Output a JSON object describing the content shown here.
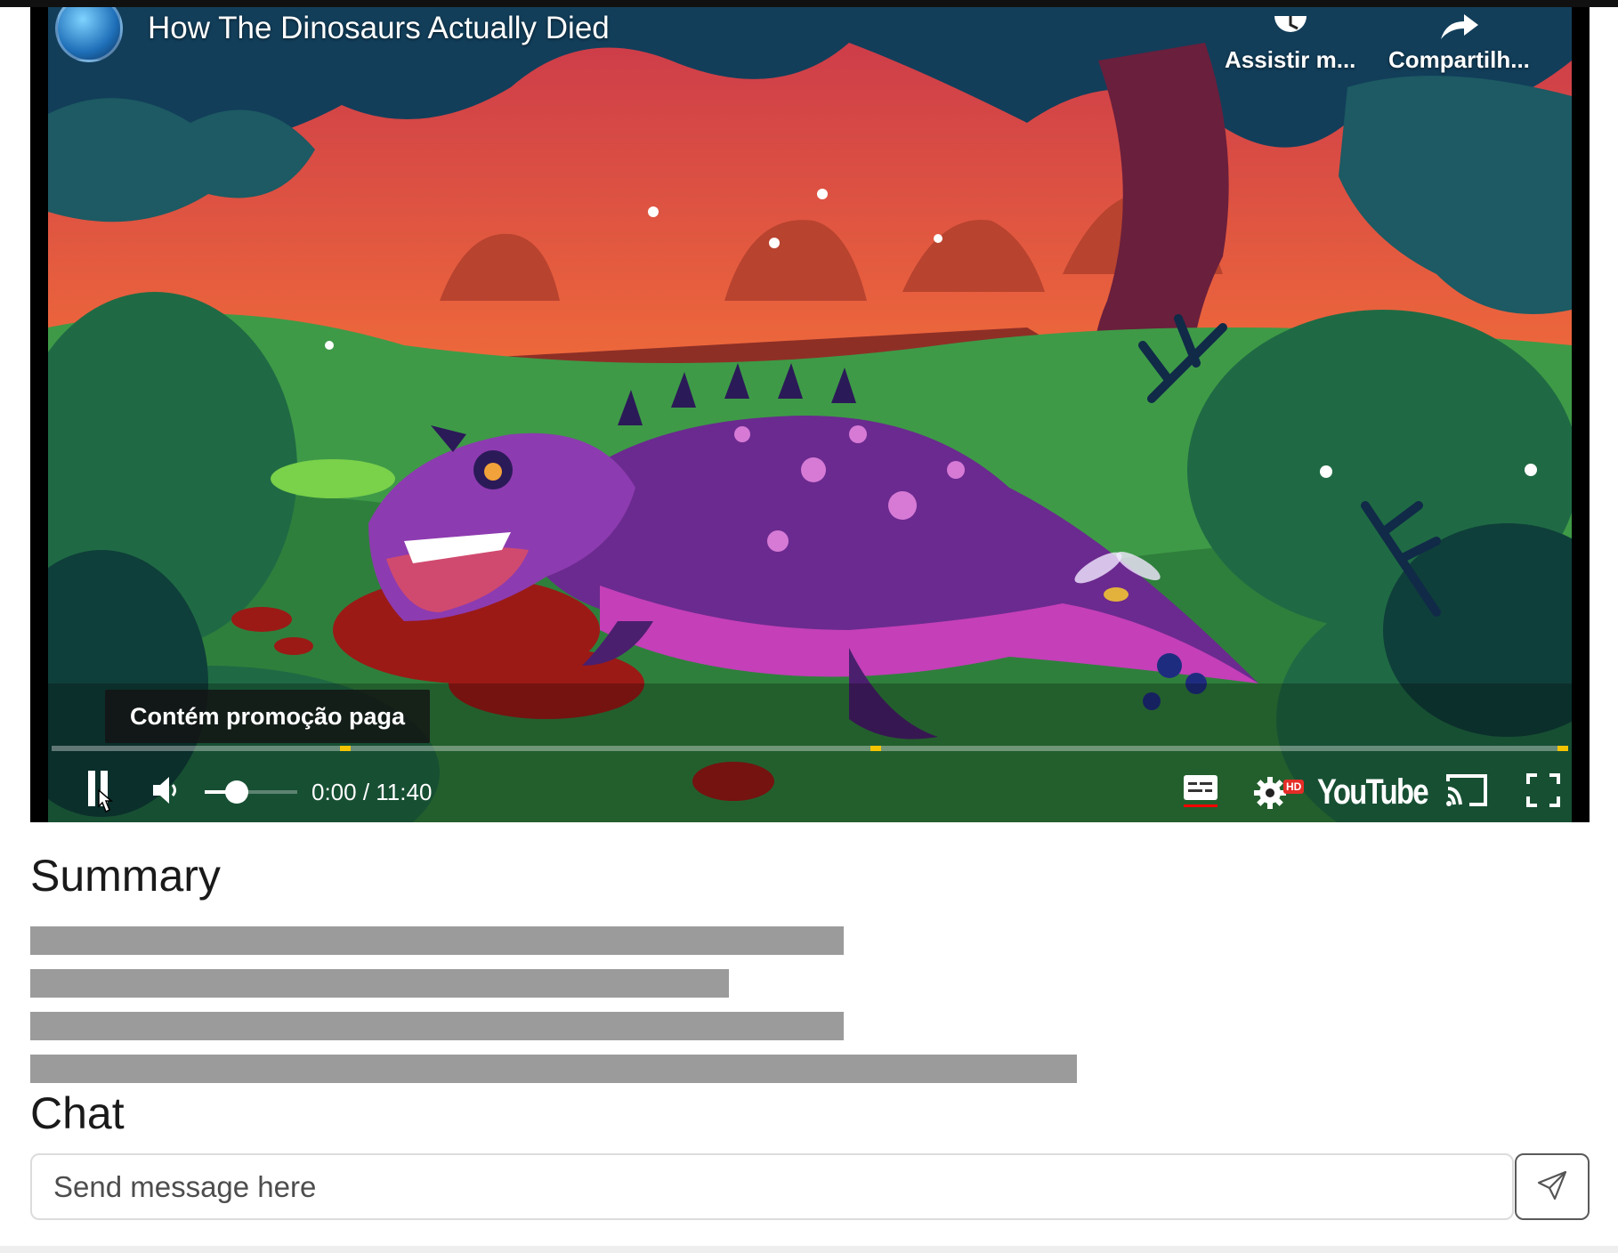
{
  "video": {
    "title": "How The Dinosaurs Actually Died",
    "channel_avatar_icon": "earth-avatar-icon",
    "actions": {
      "watch_later": {
        "label": "Assistir m...",
        "icon": "clock-icon"
      },
      "share": {
        "label": "Compartilh...",
        "icon": "share-arrow-icon"
      }
    },
    "paid_promotion": "Contém promoção paga",
    "time": "0:00 / 11:40",
    "progress_fraction": 0,
    "volume_fraction": 0.35,
    "chapter_markers_fraction": [
      0.19,
      0.54,
      0.995
    ],
    "brand": "YouTube",
    "hd_badge": "HD",
    "controls": {
      "play": "play-icon",
      "volume": "volume-icon",
      "subtitles": "subtitles-icon",
      "settings": "gear-icon",
      "cast": "cast-icon",
      "fullscreen": "fullscreen-icon"
    },
    "colors": {
      "progress": "#ff0000",
      "chapter": "#f5c400",
      "dino": "#c43fb8"
    }
  },
  "summary": {
    "heading": "Summary",
    "skeleton_line_fractions": [
      0.503,
      0.432,
      0.503,
      0.647
    ]
  },
  "chat": {
    "heading": "Chat",
    "input": {
      "placeholder": "Send message here",
      "value": ""
    },
    "send_icon": "send-icon"
  }
}
